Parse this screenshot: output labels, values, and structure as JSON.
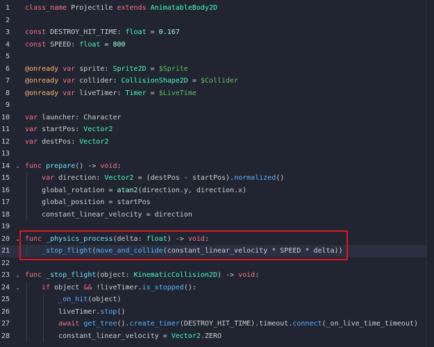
{
  "editor": {
    "language": "GDScript",
    "colors": {
      "background": "#202531",
      "current_line": "#2a3041",
      "highlight_box": "#e5141b"
    },
    "lines": [
      {
        "num": "1",
        "fold": "",
        "segments": [
          [
            "class_name",
            "kw"
          ],
          [
            " Projectile ",
            "id"
          ],
          [
            "extends",
            "kw"
          ],
          [
            " ",
            "id"
          ],
          [
            "AnimatableBody2D",
            "type"
          ]
        ]
      },
      {
        "num": "2",
        "fold": "",
        "segments": []
      },
      {
        "num": "3",
        "fold": "",
        "segments": [
          [
            "const",
            "kw"
          ],
          [
            " DESTROY_HIT_TIME: ",
            "id"
          ],
          [
            "float",
            "type"
          ],
          [
            " = ",
            "id"
          ],
          [
            "0.167",
            "num"
          ]
        ]
      },
      {
        "num": "4",
        "fold": "",
        "segments": [
          [
            "const",
            "kw"
          ],
          [
            " SPEED: ",
            "id"
          ],
          [
            "float",
            "type"
          ],
          [
            " = ",
            "id"
          ],
          [
            "800",
            "num"
          ]
        ]
      },
      {
        "num": "5",
        "fold": "",
        "segments": []
      },
      {
        "num": "6",
        "fold": "",
        "segments": [
          [
            "@onready",
            "ann"
          ],
          [
            " ",
            "id"
          ],
          [
            "var",
            "kw"
          ],
          [
            " sprite: ",
            "id"
          ],
          [
            "Sprite2D",
            "type"
          ],
          [
            " = ",
            "id"
          ],
          [
            "$Sprite",
            "node"
          ]
        ]
      },
      {
        "num": "7",
        "fold": "",
        "segments": [
          [
            "@onready",
            "ann"
          ],
          [
            " ",
            "id"
          ],
          [
            "var",
            "kw"
          ],
          [
            " collider: ",
            "id"
          ],
          [
            "CollisionShape2D",
            "type"
          ],
          [
            " = ",
            "id"
          ],
          [
            "$Collider",
            "node"
          ]
        ]
      },
      {
        "num": "8",
        "fold": "",
        "segments": [
          [
            "@onready",
            "ann"
          ],
          [
            " ",
            "id"
          ],
          [
            "var",
            "kw"
          ],
          [
            " liveTimer: ",
            "id"
          ],
          [
            "Timer",
            "type"
          ],
          [
            " = ",
            "id"
          ],
          [
            "$LiveTime",
            "node"
          ]
        ]
      },
      {
        "num": "9",
        "fold": "",
        "segments": []
      },
      {
        "num": "10",
        "fold": "",
        "segments": [
          [
            "var",
            "kw"
          ],
          [
            " launcher: ",
            "id"
          ],
          [
            "Character",
            "id"
          ]
        ]
      },
      {
        "num": "11",
        "fold": "",
        "segments": [
          [
            "var",
            "kw"
          ],
          [
            " startPos: ",
            "id"
          ],
          [
            "Vector2",
            "type"
          ]
        ]
      },
      {
        "num": "12",
        "fold": "",
        "segments": [
          [
            "var",
            "kw"
          ],
          [
            " destPos: ",
            "id"
          ],
          [
            "Vector2",
            "type"
          ]
        ]
      },
      {
        "num": "13",
        "fold": "",
        "segments": []
      },
      {
        "num": "14",
        "fold": "⌄",
        "segments": [
          [
            "func",
            "kw"
          ],
          [
            " ",
            "id"
          ],
          [
            "prepare",
            "def"
          ],
          [
            "() -> ",
            "id"
          ],
          [
            "void",
            "kw"
          ],
          [
            ":",
            "id"
          ]
        ]
      },
      {
        "num": "15",
        "fold": "",
        "segments": [
          [
            "    ",
            "id"
          ],
          [
            "var",
            "kw"
          ],
          [
            " direction: ",
            "id"
          ],
          [
            "Vector2",
            "type"
          ],
          [
            " = (destPos - startPos).",
            "id"
          ],
          [
            "normalized",
            "fn"
          ],
          [
            "()",
            "id"
          ]
        ]
      },
      {
        "num": "16",
        "fold": "",
        "segments": [
          [
            "    global_rotation = ",
            "id"
          ],
          [
            "atan2",
            "builtin"
          ],
          [
            "(direction.y, direction.x)",
            "id"
          ]
        ]
      },
      {
        "num": "17",
        "fold": "",
        "segments": [
          [
            "    global_position = startPos",
            "id"
          ]
        ]
      },
      {
        "num": "18",
        "fold": "",
        "segments": [
          [
            "    constant_linear_velocity = direction",
            "id"
          ]
        ]
      },
      {
        "num": "19",
        "fold": "",
        "segments": []
      },
      {
        "num": "20",
        "fold": "⌄",
        "segments": [
          [
            "func",
            "kw"
          ],
          [
            " ",
            "id"
          ],
          [
            "_physics_process",
            "def"
          ],
          [
            "(delta: ",
            "id"
          ],
          [
            "float",
            "type"
          ],
          [
            ") -> ",
            "id"
          ],
          [
            "void",
            "kw"
          ],
          [
            ":",
            "id"
          ]
        ]
      },
      {
        "num": "21",
        "fold": "",
        "current": true,
        "segments": [
          [
            "    ",
            "id"
          ],
          [
            "_stop_flight",
            "fn"
          ],
          [
            "(",
            "id"
          ],
          [
            "move_and_collide",
            "fn"
          ],
          [
            "(constant_linear_velocity * SPEED * delta))",
            "id"
          ]
        ]
      },
      {
        "num": "22",
        "fold": "",
        "segments": []
      },
      {
        "num": "23",
        "fold": "⌄",
        "segments": [
          [
            "func",
            "kw"
          ],
          [
            " ",
            "id"
          ],
          [
            "_stop_flight",
            "def"
          ],
          [
            "(object: ",
            "id"
          ],
          [
            "KinematicCollision2D",
            "type"
          ],
          [
            ") -> ",
            "id"
          ],
          [
            "void",
            "kw"
          ],
          [
            ":",
            "id"
          ]
        ]
      },
      {
        "num": "24",
        "fold": "⌄",
        "segments": [
          [
            "    ",
            "id"
          ],
          [
            "if",
            "kw"
          ],
          [
            " object ",
            "id"
          ],
          [
            "&&",
            "kw"
          ],
          [
            " !liveTimer.",
            "id"
          ],
          [
            "is_stopped",
            "fn"
          ],
          [
            "():",
            "id"
          ]
        ]
      },
      {
        "num": "25",
        "fold": "",
        "segments": [
          [
            "        ",
            "id"
          ],
          [
            "_on_hit",
            "fn"
          ],
          [
            "(object)",
            "id"
          ]
        ]
      },
      {
        "num": "26",
        "fold": "",
        "segments": [
          [
            "        liveTimer.",
            "id"
          ],
          [
            "stop",
            "fn"
          ],
          [
            "()",
            "id"
          ]
        ]
      },
      {
        "num": "27",
        "fold": "",
        "segments": [
          [
            "        ",
            "id"
          ],
          [
            "await",
            "kw"
          ],
          [
            " ",
            "id"
          ],
          [
            "get_tree",
            "fn"
          ],
          [
            "().",
            "id"
          ],
          [
            "create_timer",
            "fn"
          ],
          [
            "(DESTROY_HIT_TIME).timeout.",
            "id"
          ],
          [
            "connect",
            "fn"
          ],
          [
            "(_on_live_time_timeout)",
            "id"
          ]
        ]
      },
      {
        "num": "28",
        "fold": "",
        "segments": [
          [
            "        constant_linear_velocity = ",
            "id"
          ],
          [
            "Vector2",
            "type"
          ],
          [
            ".ZERO",
            "id"
          ]
        ]
      }
    ]
  }
}
